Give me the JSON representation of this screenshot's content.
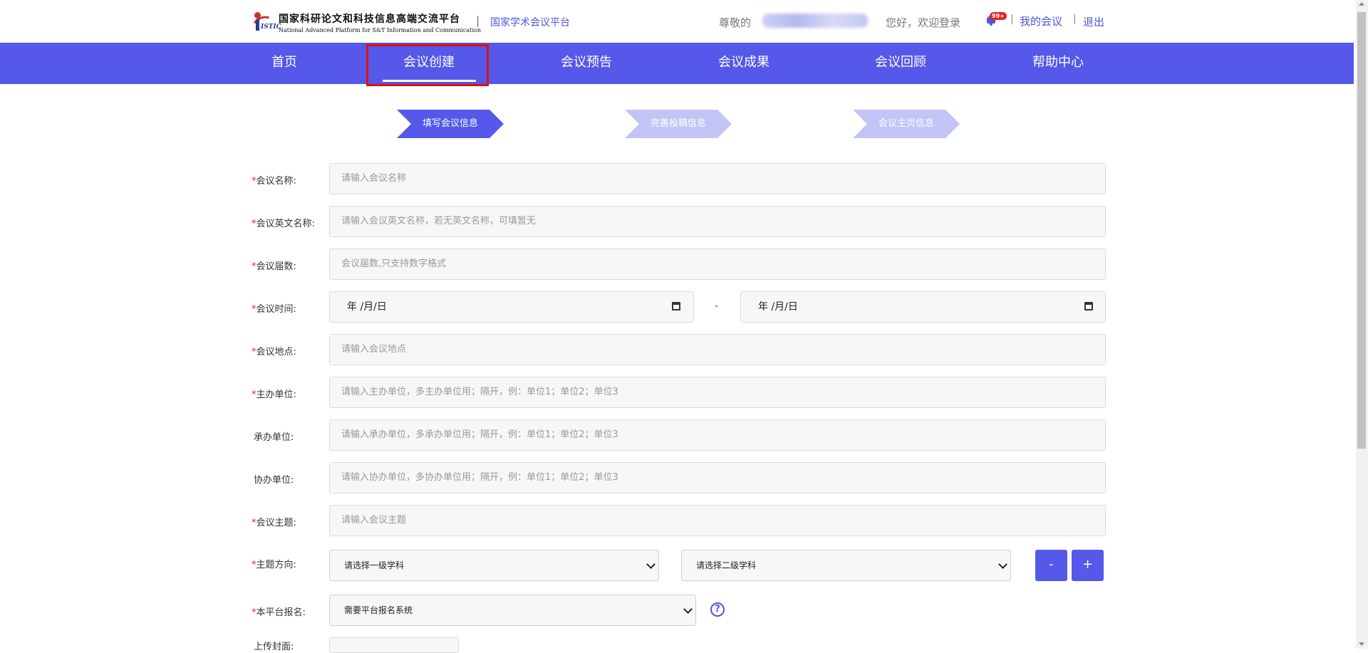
{
  "header": {
    "logo_cn": "国家科研论文和科技信息高端交流平台",
    "logo_en": "National Advanced Platform for S&T Information and Communication",
    "logo_mark_text": "ISTIC",
    "separator": "|",
    "platform_name": "国家学术会议平台",
    "greeting": "尊敬的",
    "username_redacted": true,
    "welcome": "您好，欢迎登录",
    "notification_badge": "99+",
    "my_meeting": "我的会议",
    "logout": "退出"
  },
  "nav": {
    "items": [
      {
        "label": "首页"
      },
      {
        "label": "会议创建",
        "active": true
      },
      {
        "label": "会议预告"
      },
      {
        "label": "会议成果"
      },
      {
        "label": "会议回顾"
      },
      {
        "label": "帮助中心"
      }
    ]
  },
  "steps": [
    {
      "label": "填写会议信息",
      "active": true
    },
    {
      "label": "完善投稿信息",
      "active": false
    },
    {
      "label": "会议主页信息",
      "active": false
    }
  ],
  "form": {
    "name": {
      "label": "会议名称:",
      "required": true,
      "placeholder": "请输入会议名称"
    },
    "english_name": {
      "label": "会议英文名称:",
      "required": true,
      "placeholder": "请输入会议英文名称，若无英文名称，可填暂无"
    },
    "session": {
      "label": "会议届数:",
      "required": true,
      "placeholder": "会议届数,只支持数字格式"
    },
    "time": {
      "label": "会议时间:",
      "required": true,
      "start_placeholder": "年 /月/日",
      "separator": "-",
      "end_placeholder": "年 /月/日"
    },
    "location": {
      "label": "会议地点:",
      "required": true,
      "placeholder": "请输入会议地点"
    },
    "host": {
      "label": "主办单位:",
      "required": true,
      "placeholder": "请输入主办单位，多主办单位用；隔开，例：单位1；单位2；单位3"
    },
    "organizer": {
      "label": "承办单位:",
      "required": false,
      "placeholder": "请输入承办单位，多承办单位用；隔开，例：单位1；单位2；单位3"
    },
    "co_organizer": {
      "label": "协办单位:",
      "required": false,
      "placeholder": "请输入协办单位，多协办单位用；隔开，例：单位1；单位2；单位3"
    },
    "theme": {
      "label": "会议主题:",
      "required": true,
      "placeholder": "请输入会议主题"
    },
    "direction": {
      "label": "主题方向:",
      "required": true,
      "primary_selected": "请选择一级学科",
      "secondary_selected": "请选择二级学科",
      "remove_label": "-",
      "add_label": "+"
    },
    "registration": {
      "label": "本平台报名:",
      "required": true,
      "selected": "需要平台报名系统",
      "help_icon": "?"
    },
    "cover": {
      "label": "上传封面:",
      "required": false
    }
  },
  "colors": {
    "brand": "#5558e8",
    "brand_text": "#4f56d9",
    "required": "#e02424",
    "highlight": "#e00f0f"
  }
}
